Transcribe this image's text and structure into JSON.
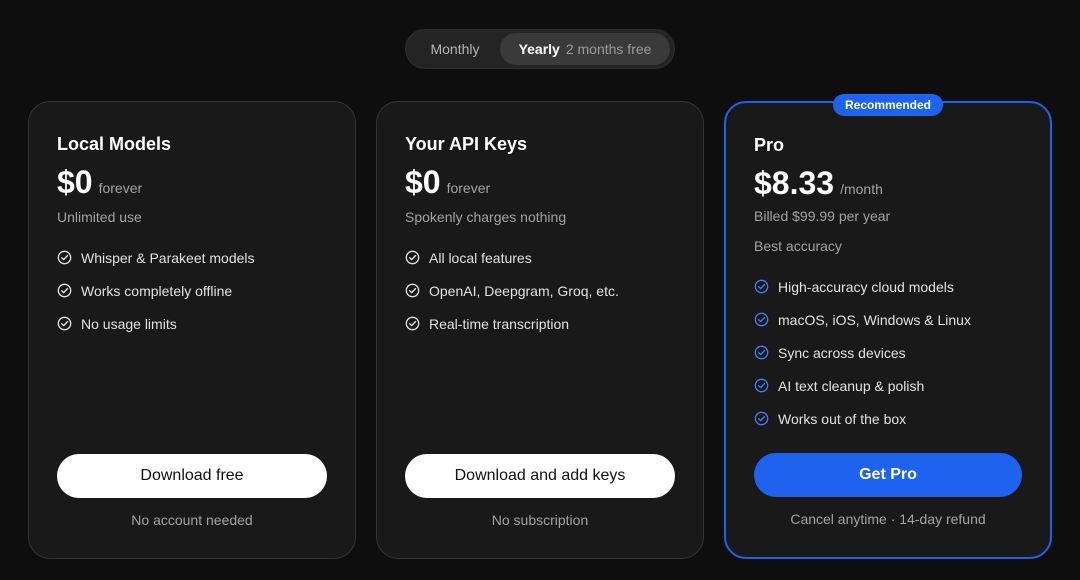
{
  "billing_toggle": {
    "monthly_label": "Monthly",
    "yearly_label": "Yearly",
    "yearly_note": "2 months free",
    "selected": "Yearly"
  },
  "plans": [
    {
      "name": "Local Models",
      "price": "$0",
      "period": "forever",
      "description": "Unlimited use",
      "features": [
        "Whisper & Parakeet models",
        "Works completely offline",
        "No usage limits"
      ],
      "button_label": "Download free",
      "footnote": "No account needed"
    },
    {
      "name": "Your API Keys",
      "price": "$0",
      "period": "forever",
      "description": "Spokenly charges nothing",
      "features": [
        "All local features",
        "OpenAI, Deepgram, Groq, etc.",
        "Real-time transcription"
      ],
      "button_label": "Download and add keys",
      "footnote": "No subscription"
    },
    {
      "badge": "Recommended",
      "name": "Pro",
      "price": "$8.33",
      "period": "/month",
      "billing_note": "Billed $99.99 per year",
      "description": "Best accuracy",
      "features": [
        "High-accuracy cloud models",
        "macOS, iOS, Windows & Linux",
        "Sync across devices",
        "AI text cleanup & polish",
        "Works out of the box"
      ],
      "button_label": "Get Pro",
      "footnote": "Cancel anytime · 14-day refund"
    }
  ],
  "colors": {
    "background": "#0e0e0e",
    "card": "#191919",
    "accent_blue": "#1e63f0",
    "muted_text": "#a3a3a3"
  },
  "icons": {
    "feature_check": "check-circle-icon"
  }
}
